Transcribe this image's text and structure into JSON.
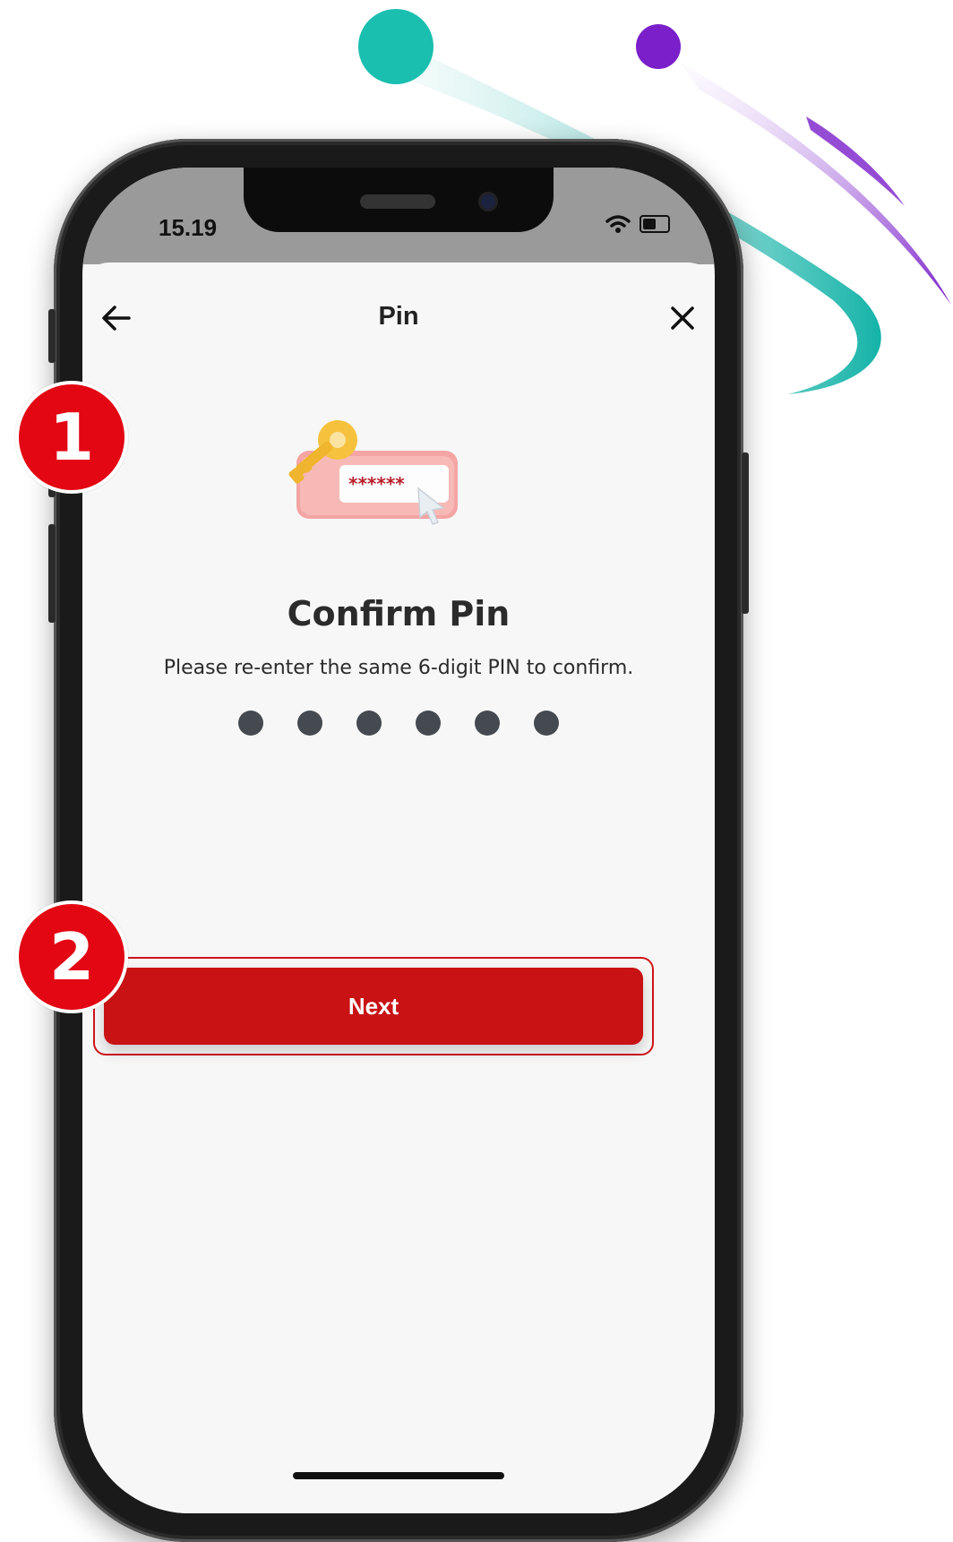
{
  "status_bar": {
    "time": "15.19",
    "icons": [
      "wifi-icon",
      "battery-icon"
    ]
  },
  "header": {
    "title": "Pin",
    "back_icon": "arrow-left-icon",
    "close_icon": "close-icon"
  },
  "content": {
    "illustration_icon": "key-password-icon",
    "illustration_mask": "******",
    "title": "Confirm Pin",
    "subtitle": "Please re-enter the same 6-digit PIN to confirm.",
    "pin_filled_count": 6,
    "pin_length": 6
  },
  "actions": {
    "next_label": "Next"
  },
  "annotations": {
    "step1": "1",
    "step2": "2"
  },
  "colors": {
    "primary_red": "#c81214",
    "badge_red": "#e30613",
    "teal": "#1abfb0",
    "purple": "#7a1fc9"
  }
}
